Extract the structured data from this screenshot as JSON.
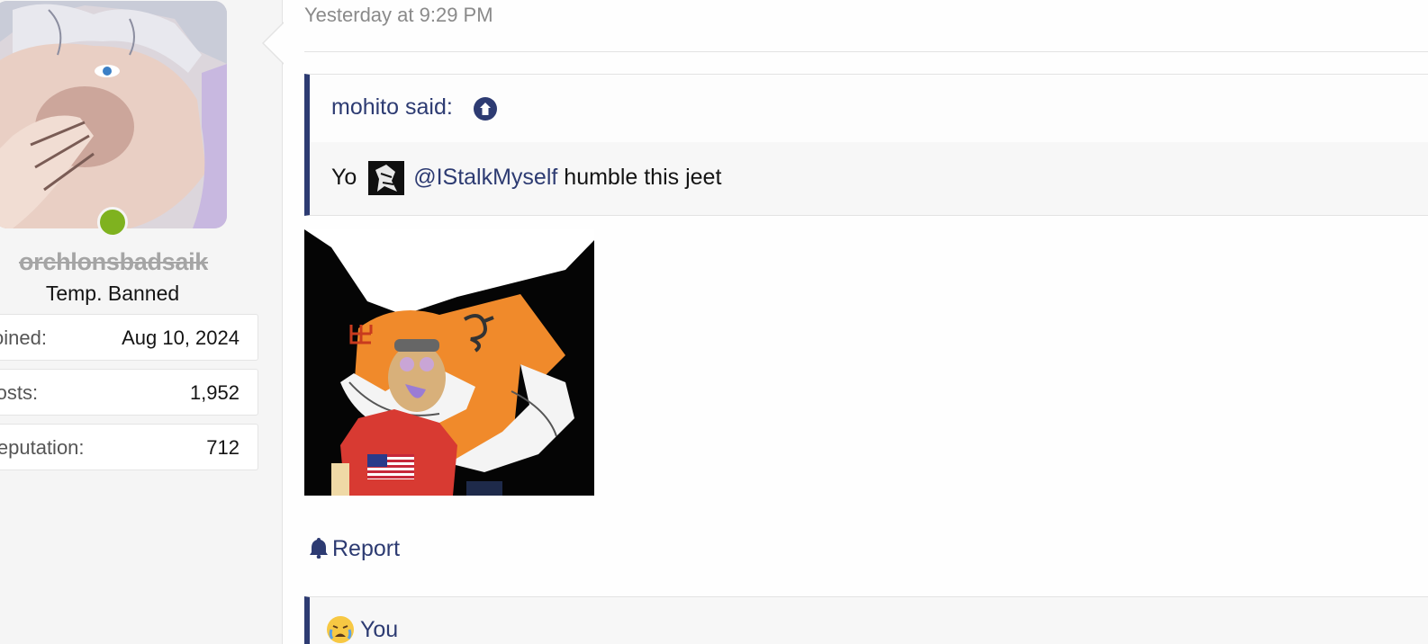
{
  "user": {
    "username": "orchlonsbadsaik",
    "title": "Temp. Banned",
    "online": true,
    "stats": [
      {
        "label": "Joined:",
        "value": "Aug 10, 2024"
      },
      {
        "label": "Posts:",
        "value": "1,952"
      },
      {
        "label": "Reputation:",
        "value": "712"
      }
    ]
  },
  "post": {
    "timestamp": "Yesterday at 9:29 PM",
    "quote": {
      "author": "mohito said:",
      "text_before": "Yo",
      "mention": "@IStalkMyself",
      "text_after": "humble this jeet"
    },
    "report_label": "Report",
    "reaction": {
      "emoji": "weary-face-icon",
      "label": "You"
    }
  },
  "colors": {
    "link": "#2d3b72",
    "online": "#7fb21f",
    "banned_name": "#a5a5a5",
    "quote_border": "#2d3b72"
  }
}
